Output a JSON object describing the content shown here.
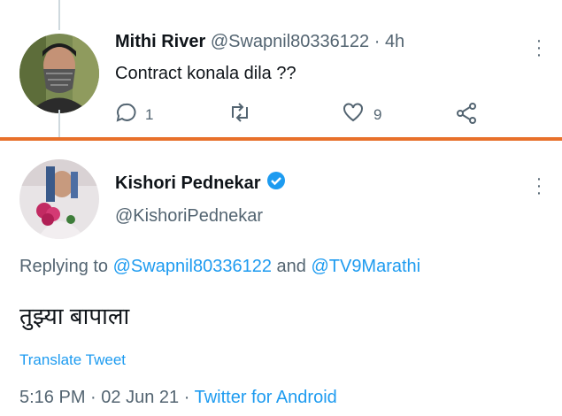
{
  "reply_tweet": {
    "name": "Mithi River",
    "handle": "@Swapnil80336122",
    "time": "4h",
    "text": "Contract konala dila ??",
    "reply_count": "1",
    "like_count": "9"
  },
  "main_tweet": {
    "name": "Kishori  Pednekar",
    "handle": "@KishoriPednekar",
    "replying_prefix": "Replying to",
    "replying_user1": "@Swapnil80336122",
    "replying_and": "and",
    "replying_user2": "@TV9Marathi",
    "text": "तुझ्या बापाला",
    "translate_label": "Translate Tweet",
    "time": "5:16 PM",
    "date": "02 Jun 21",
    "source": "Twitter for Android"
  },
  "colors": {
    "accent": "#1d9bf0",
    "separator": "#e8702a",
    "muted": "#536471",
    "text": "#0f1419"
  },
  "icons": [
    "reply-icon",
    "retweet-icon",
    "like-icon",
    "share-icon",
    "more-icon",
    "verified-badge-icon"
  ]
}
